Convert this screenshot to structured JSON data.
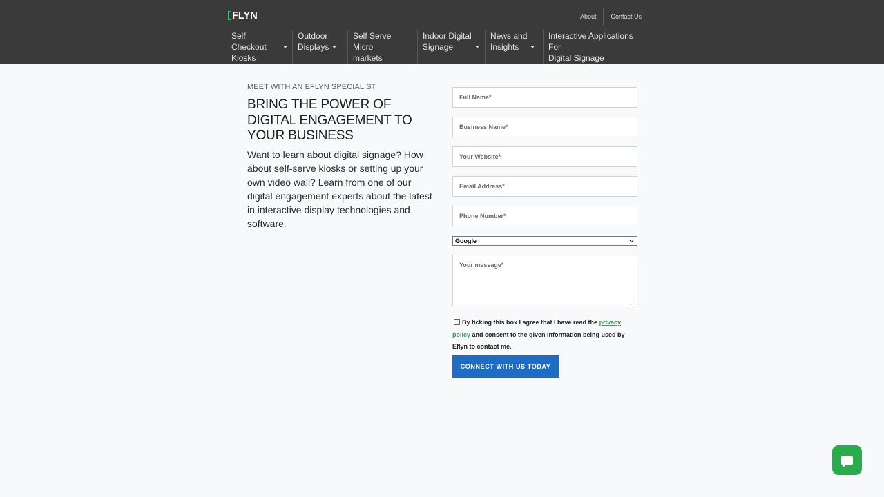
{
  "brand": {
    "logo_text": "FLYN",
    "accent": "#2ec56e"
  },
  "utility_nav": [
    {
      "label": "About"
    },
    {
      "label": "Contact Us"
    }
  ],
  "main_nav": [
    {
      "label": "Self Checkout\nKiosks",
      "has_dropdown": true
    },
    {
      "label": "Outdoor\nDisplays",
      "has_dropdown": true
    },
    {
      "label": "Self Serve Micro\nmarkets",
      "has_dropdown": false
    },
    {
      "label": "Indoor Digital\nSignage",
      "has_dropdown": true
    },
    {
      "label": "News and\nInsights",
      "has_dropdown": true
    },
    {
      "label": "Interactive Applications For\nDigital Signage",
      "has_dropdown": false
    }
  ],
  "intro": {
    "eyebrow": "MEET WITH AN EFLYN SPECIALIST",
    "headline": "BRING THE POWER OF DIGITAL ENGAGEMENT TO YOUR BUSINESS",
    "body": "Want to learn about digital signage? How about self-serve kiosks or setting up your own video wall? Learn from one of our digital engagement experts about the latest in interactive display technologies and software."
  },
  "form": {
    "fields": [
      {
        "placeholder": "Full Name*"
      },
      {
        "placeholder": "Business Name*"
      },
      {
        "placeholder": "Your Website*"
      },
      {
        "placeholder": "Email Address*"
      },
      {
        "placeholder": "Phone Number*"
      }
    ],
    "source_select": {
      "selected": "Google"
    },
    "message_placeholder": "Your message*",
    "consent_before": "By ticking this box I agree that I have read the ",
    "consent_link": "privacy policy",
    "consent_after": " and consent to the given information being used by Eflyn to contact me.",
    "consent_checked": false,
    "submit_label": "CONNECT WITH US TODAY"
  },
  "colors": {
    "header_bg": "#3a3a3a",
    "page_bg": "#f7f9fa",
    "button_bg": "#1f6cc5",
    "link": "#28a745",
    "chat_bg": "#28ad4b"
  },
  "chat_widget": {
    "icon": "chat-bubble-icon"
  }
}
